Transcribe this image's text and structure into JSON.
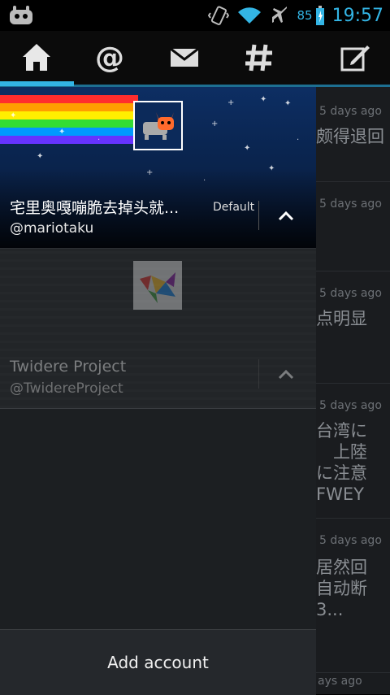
{
  "status_bar": {
    "battery": "85",
    "time": "19:57"
  },
  "tabs": [
    {
      "name": "home-icon"
    },
    {
      "name": "mention-icon"
    },
    {
      "name": "message-icon"
    },
    {
      "name": "hashtag-icon"
    },
    {
      "name": "compose-icon"
    }
  ],
  "accounts": [
    {
      "name": "宅里奥嘎嘣脆去掉头就...",
      "handle": "@mariotaku",
      "tag": "Default"
    },
    {
      "name": "Twidere Project",
      "handle": "@TwidereProject",
      "tag": ""
    }
  ],
  "add_account_label": "Add account",
  "timeline": [
    {
      "time": "5 days ago",
      "lines": [
        "颇得退回"
      ]
    },
    {
      "time": "5 days ago",
      "lines": []
    },
    {
      "time": "5 days ago",
      "lines": [
        "点明显"
      ]
    },
    {
      "time": "5 days ago",
      "lines": [
        "台湾に",
        "　上陸",
        "に注意",
        "FWEY"
      ]
    },
    {
      "time": "5 days ago",
      "lines": [
        "居然回",
        "自动断",
        "3..."
      ]
    },
    {
      "time": "ays ago",
      "lines": []
    }
  ],
  "colors": {
    "accent": "#33b5e5",
    "green_marker": "#7cb342",
    "orange_marker": "#a0622d"
  }
}
